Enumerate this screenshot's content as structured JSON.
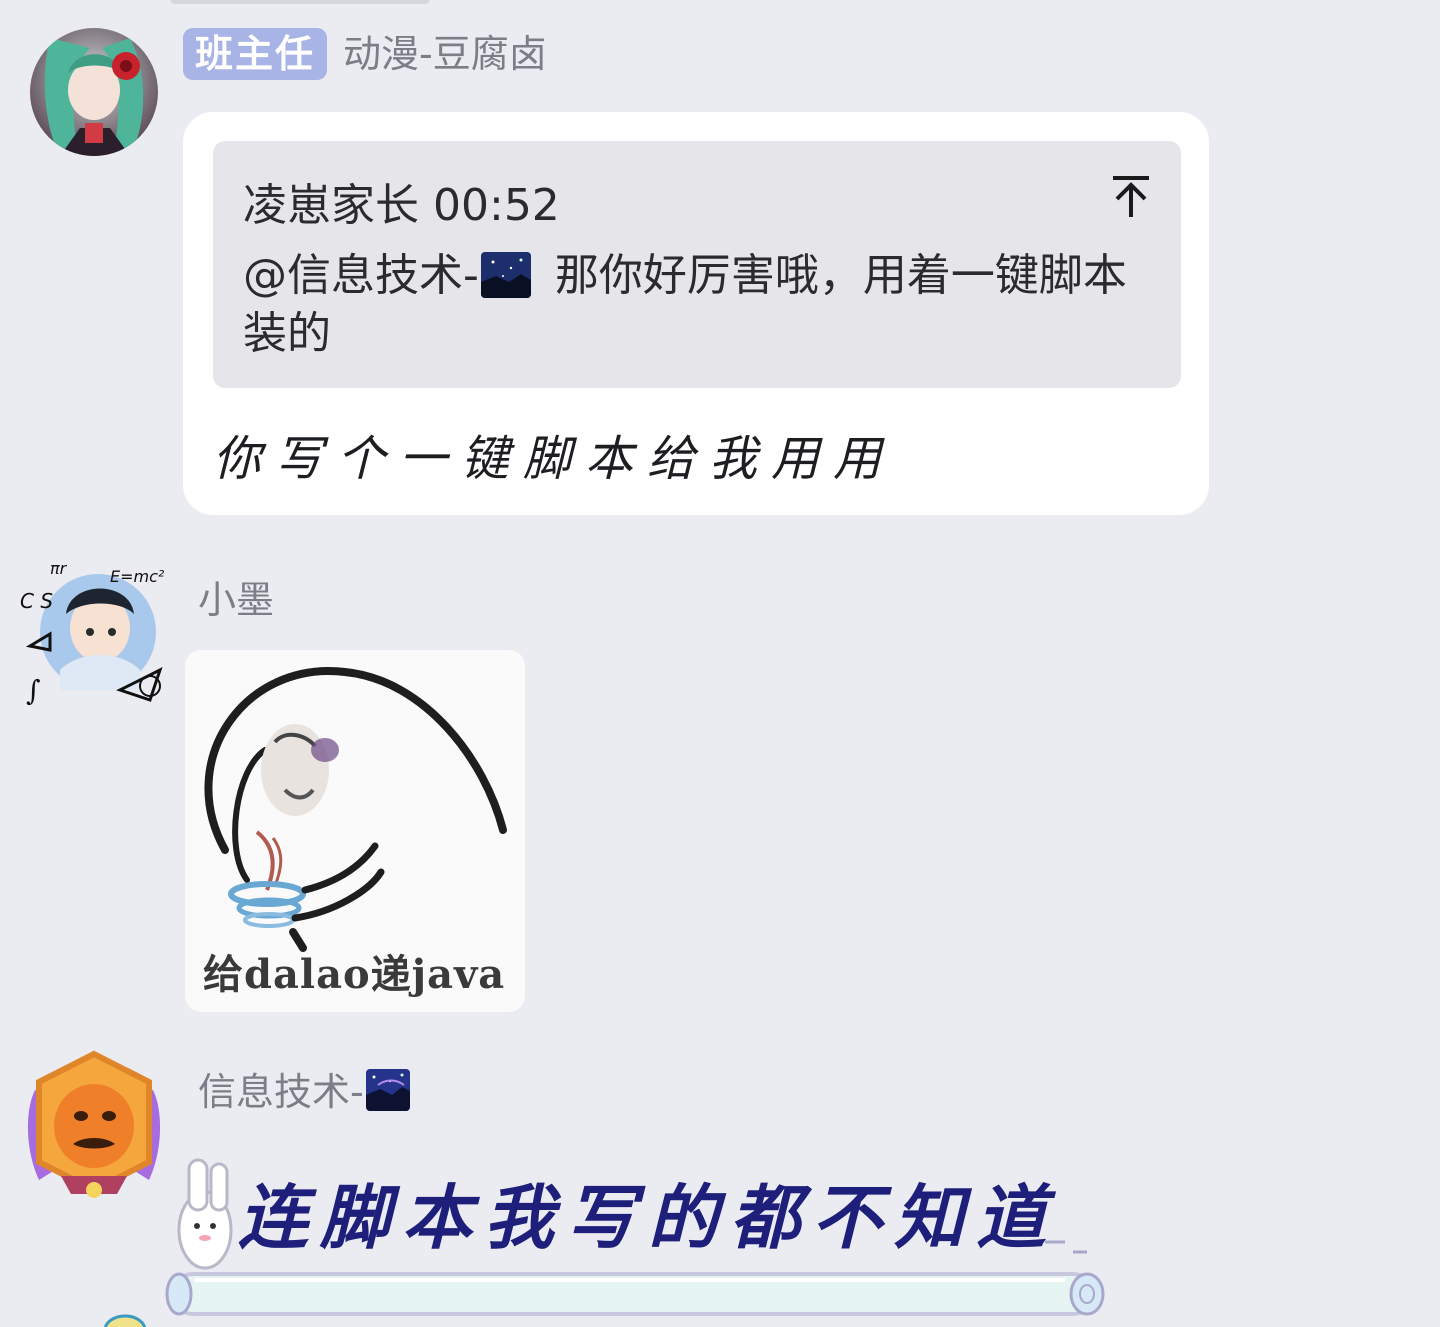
{
  "messages": [
    {
      "badge": "班主任",
      "sender": "动漫-豆腐卤",
      "avatar": "anime-avatar-green-hair",
      "quote": {
        "author": "凌崽家长",
        "time": "00:52",
        "mention": "@信息技术-",
        "mention_emoji": "night-sky-emoji",
        "text_rest": " 那你好厉害哦，用着一键脚本装的",
        "pin_icon": "pin-top-icon"
      },
      "text": "你写个一键脚本给我用用"
    },
    {
      "sender": "小墨",
      "avatar": "anime-avatar-math-symbols",
      "image": {
        "caption": "给dalao递java",
        "icon": "meme-sticker-image"
      }
    },
    {
      "sender": "信息技术-",
      "sender_emoji": "night-sky-emoji",
      "avatar": "orange-mascot-avatar",
      "text": "连脚本我写的都不知道"
    }
  ],
  "colors": {
    "background": "#ebebf2",
    "badge": "#a8b4e6",
    "bubble": "#ffffff",
    "quote_bg": "#e6e6ea",
    "sticker_text": "#1d1f7a"
  }
}
